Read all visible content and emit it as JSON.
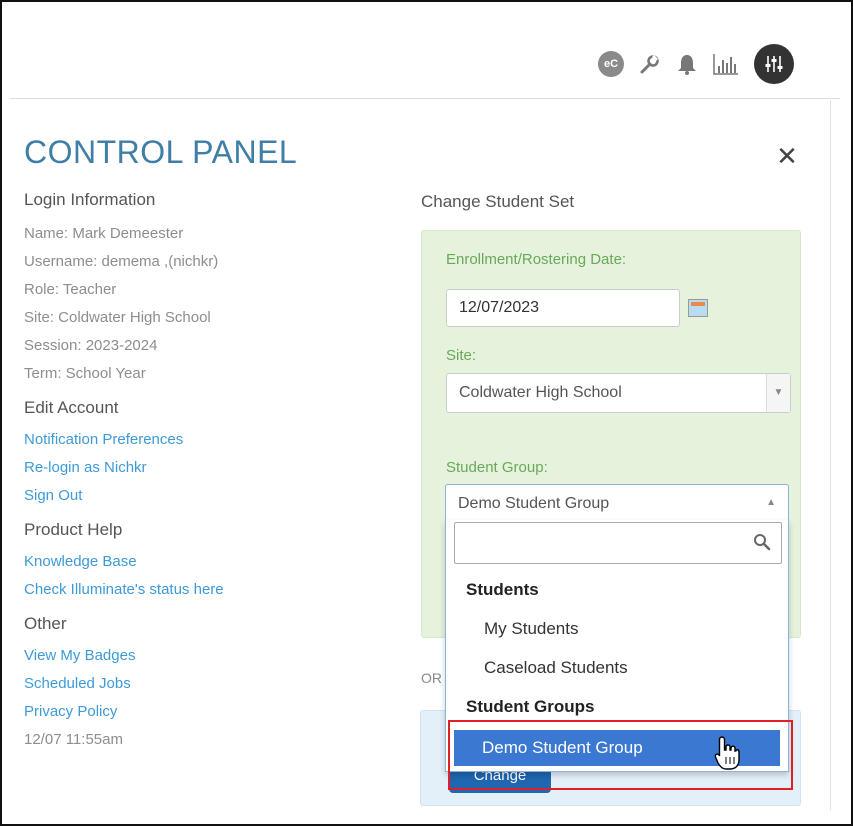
{
  "header": {
    "icons": [
      "ec-icon",
      "wrench-icon",
      "bell-icon",
      "chart-icon",
      "mixer-avatar-icon"
    ],
    "ec_label": "eC"
  },
  "panel": {
    "title": "CONTROL PANEL",
    "close_label": "✕"
  },
  "login": {
    "heading": "Login Information",
    "lines": [
      "Name: Mark Demeester",
      "Username: demema ,(nichkr)",
      "Role: Teacher",
      "Site: Coldwater High School",
      "Session: 2023-2024",
      "Term: School Year"
    ]
  },
  "edit_account": {
    "heading": "Edit Account",
    "links": [
      "Notification Preferences",
      "Re-login as Nichkr",
      "Sign Out"
    ]
  },
  "product_help": {
    "heading": "Product Help",
    "links": [
      "Knowledge Base",
      "Check Illuminate's status here"
    ]
  },
  "other": {
    "heading": "Other",
    "links": [
      "View My Badges",
      "Scheduled Jobs",
      "Privacy Policy"
    ],
    "timestamp": "12/07 11:55am"
  },
  "student_set": {
    "heading": "Change Student Set",
    "date_label": "Enrollment/Rostering Date:",
    "date_value": "12/07/2023",
    "site_label": "Site:",
    "site_value": "Coldwater High School",
    "group_label": "Student Group:",
    "group_value": "Demo Student Group",
    "or_text": "OR",
    "change_button": "Change"
  },
  "dropdown": {
    "search_placeholder": "",
    "group1": "Students",
    "options1": [
      "My Students",
      "Caseload Students"
    ],
    "group2": "Student Groups",
    "selected": "Demo Student Group"
  },
  "colors": {
    "title": "#3f7ea6",
    "link": "#3d9ad6",
    "green_panel": "#e5f3dc",
    "highlight": "#3b78d2",
    "annotation": "#e21f26"
  }
}
